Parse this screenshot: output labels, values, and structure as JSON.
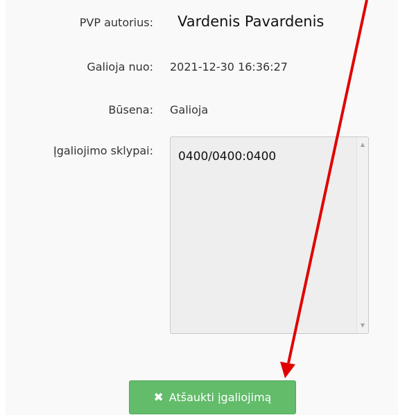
{
  "fields": {
    "author_label": "PVP autorius:",
    "author_value": "Vardenis Pavardenis",
    "valid_from_label": "Galioja nuo:",
    "valid_from_value": "2021-12-30 16:36:27",
    "status_label": "Būsena:",
    "status_value": "Galioja",
    "parcels_label": "Įgaliojimo sklypai:",
    "parcels_value": "0400/0400:0400"
  },
  "actions": {
    "revoke_icon": "close-icon",
    "revoke_label": "Atšaukti įgaliojimą"
  },
  "annotation": {
    "arrow_color": "#e00000",
    "button_color": "#62bc6a"
  }
}
